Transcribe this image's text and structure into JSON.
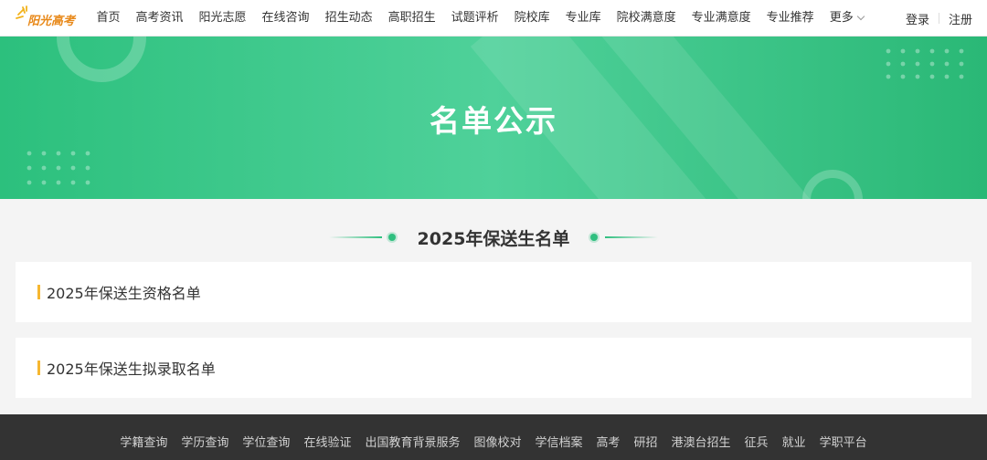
{
  "header": {
    "logo_text": "阳光高考",
    "nav": [
      "首页",
      "高考资讯",
      "阳光志愿",
      "在线咨询",
      "招生动态",
      "高职招生",
      "试题评析",
      "院校库",
      "专业库",
      "院校满意度",
      "专业满意度",
      "专业推荐"
    ],
    "more_label": "更多",
    "login_label": "登录",
    "register_label": "注册"
  },
  "banner": {
    "title": "名单公示"
  },
  "section": {
    "title": "2025年保送生名单"
  },
  "list": [
    {
      "label": "2025年保送生资格名单"
    },
    {
      "label": "2025年保送生拟录取名单"
    }
  ],
  "footer": {
    "links": [
      "学籍查询",
      "学历查询",
      "学位查询",
      "在线验证",
      "出国教育背景服务",
      "图像校对",
      "学信档案",
      "高考",
      "研招",
      "港澳台招生",
      "征兵",
      "就业",
      "学职平台"
    ]
  },
  "colors": {
    "brand_green": "#2cc07d",
    "accent_yellow": "#f6b731",
    "footer_bg": "#333333"
  },
  "icons": [
    "sun-logo-icon",
    "chevron-down-icon"
  ]
}
